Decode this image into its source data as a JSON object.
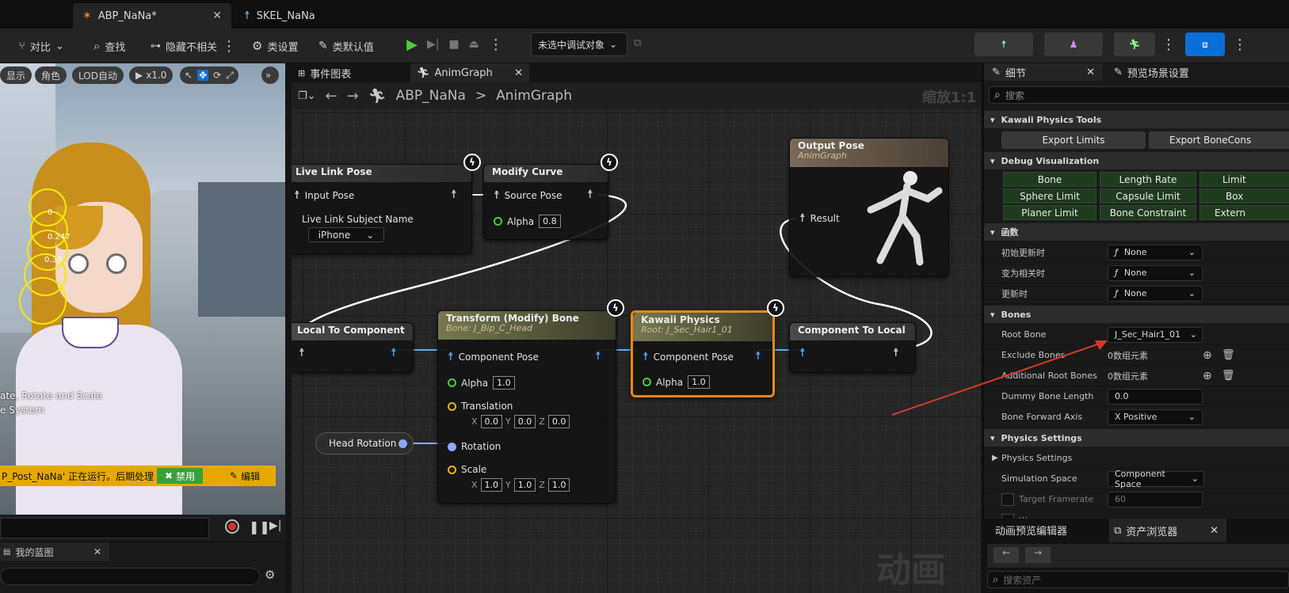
{
  "titlebar": {
    "tabs": [
      {
        "label": "ABP_NaNa*",
        "active": true
      },
      {
        "label": "SKEL_NaNa",
        "active": false
      }
    ]
  },
  "toolbar": {
    "diff_label": "对比",
    "find_label": "查找",
    "hide_unrelated_label": "隐藏不相关",
    "class_settings_label": "类设置",
    "class_defaults_label": "类默认值",
    "debug_target": "未选中调试对象"
  },
  "viewport": {
    "buttons": [
      "显示",
      "角色",
      "LOD自动",
      "x1.0"
    ],
    "overlay_text_1": "ate, Rotate and Scale",
    "overlay_text_2": "e System",
    "markers": [
      "0",
      "0.247",
      "0.39"
    ],
    "warning": {
      "text": "P_Post_NaNa' 正在运行。后期处理",
      "disable_label": "禁用",
      "edit_label": "编辑"
    }
  },
  "my_blueprint": {
    "title": "我的蓝图"
  },
  "graph": {
    "tabs": [
      {
        "label": "事件图表"
      },
      {
        "label": "AnimGraph"
      }
    ],
    "breadcrumb": {
      "root": "ABP_NaNa",
      "separator": ">",
      "current": "AnimGraph"
    },
    "zoom": "缩放1:1",
    "watermark": "动画",
    "nodes": {
      "live_link": {
        "title": "Live Link Pose",
        "input_pose": "Input Pose",
        "subject_label": "Live Link Subject Name",
        "subject_value": "iPhone"
      },
      "modify_curve": {
        "title": "Modify Curve",
        "source_pose": "Source Pose",
        "alpha_label": "Alpha",
        "alpha": "0.8"
      },
      "output_pose": {
        "title": "Output Pose",
        "subtitle": "AnimGraph",
        "result": "Result"
      },
      "local_to_component": {
        "title": "Local To Component"
      },
      "transform_bone": {
        "title": "Transform (Modify) Bone",
        "subtitle": "Bone: J_Bip_C_Head",
        "component_pose": "Component Pose",
        "alpha_label": "Alpha",
        "alpha": "1.0",
        "translation_label": "Translation",
        "translation": [
          "0.0",
          "0.0",
          "0.0"
        ],
        "rotation_label": "Rotation",
        "scale_label": "Scale",
        "scale": [
          "1.0",
          "1.0",
          "1.0"
        ]
      },
      "kawaii": {
        "title": "Kawaii Physics",
        "subtitle": "Root: J_Sec_Hair1_01",
        "component_pose": "Component Pose",
        "alpha_label": "Alpha",
        "alpha": "1.0"
      },
      "component_to_local": {
        "title": "Component To Local"
      },
      "head_rotation": {
        "title": "Head Rotation"
      }
    }
  },
  "details": {
    "tabs": [
      {
        "label": "细节"
      },
      {
        "label": "预览场景设置"
      }
    ],
    "search_placeholder": "搜索",
    "kawaii_tools": {
      "title": "Kawaii Physics Tools",
      "export_limits": "Export Limits",
      "export_bone": "Export BoneCons"
    },
    "debug_viz": {
      "title": "Debug Visualization",
      "buttons": [
        "Bone",
        "Length Rate",
        "Limit",
        "Sphere Limit",
        "Capsule Limit",
        "Box",
        "Planer Limit",
        "Bone Constraint",
        "Extern"
      ]
    },
    "functions": {
      "title": "函数",
      "rows": [
        {
          "label": "初始更新时",
          "value": "None"
        },
        {
          "label": "变为相关时",
          "value": "None"
        },
        {
          "label": "更新时",
          "value": "None"
        }
      ]
    },
    "bones": {
      "title": "Bones",
      "root_bone_label": "Root Bone",
      "root_bone": "J_Sec_Hair1_01",
      "exclude_label": "Exclude Bones",
      "exclude_value": "0数组元素",
      "additional_label": "Additional Root Bones",
      "additional_value": "0数组元素",
      "dummy_label": "Dummy Bone Length",
      "dummy_value": "0.0",
      "forward_label": "Bone Forward Axis",
      "forward_value": "X Positive"
    },
    "physics": {
      "title": "Physics Settings",
      "sub_label": "Physics Settings",
      "space_label": "Simulation Space",
      "space_value": "Component Space",
      "framerate_label": "Target Framerate",
      "framerate_value": "60",
      "cut_label": "W"
    }
  },
  "bottom_tabs": {
    "anim_preview": "动画预览编辑器",
    "asset_browser": "资产浏览器",
    "search_placeholder": "搜索资产"
  },
  "colors": {
    "accent_blue": "#0a6fd8",
    "kawaii_border": "#e88a10",
    "pose_wire": "#5ab0ff",
    "play_green": "#4fcc3a"
  }
}
